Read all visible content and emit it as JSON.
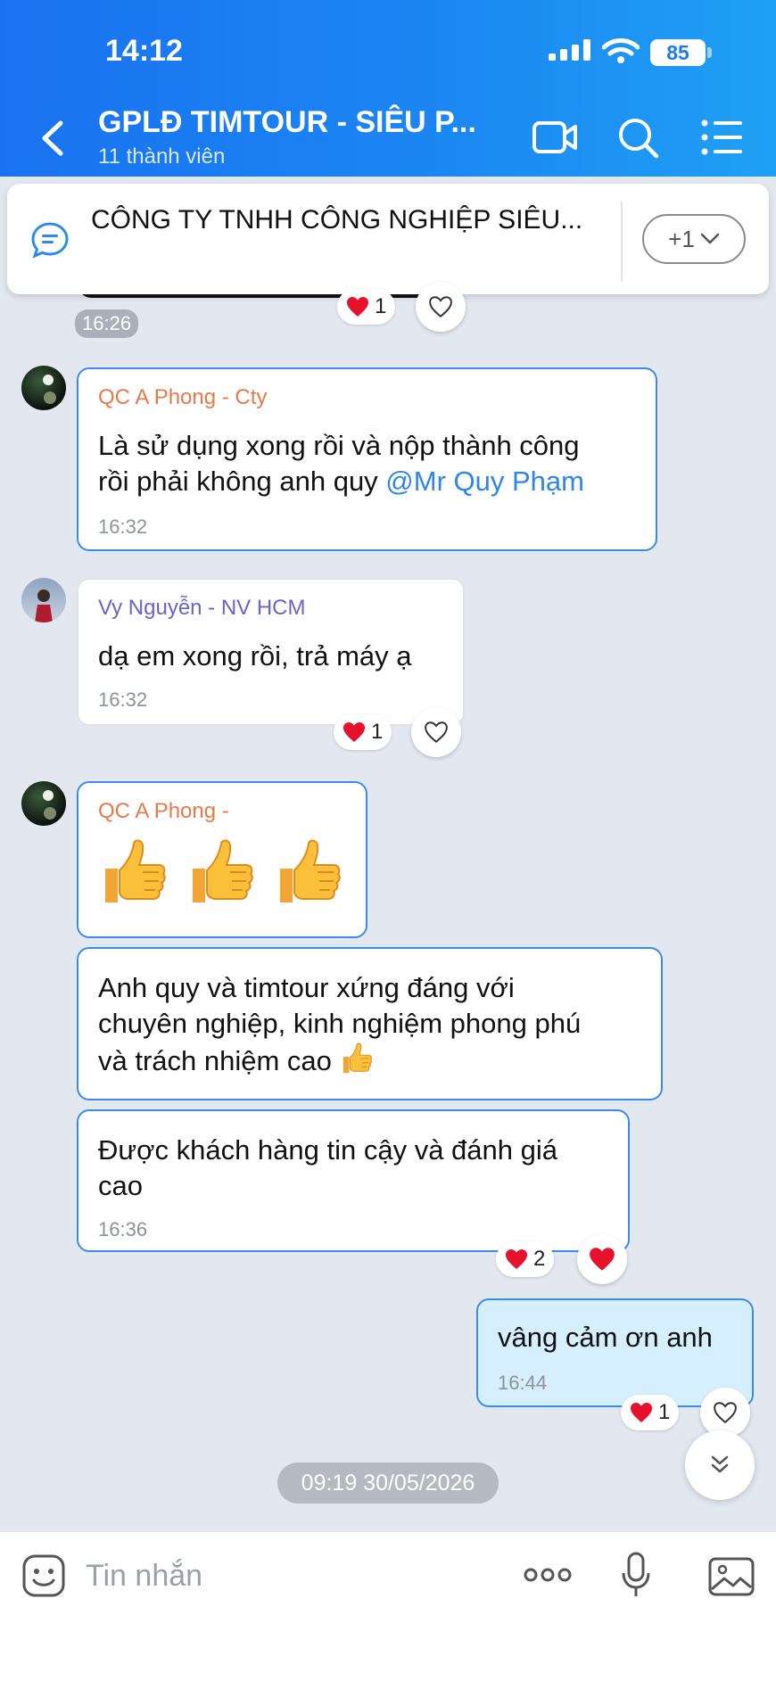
{
  "status_bar": {
    "time": "14:12",
    "battery": "85"
  },
  "header": {
    "title": "GPLĐ TIMTOUR - SIÊU P...",
    "subtitle": "11 thành viên"
  },
  "pinned": {
    "text": "CÔNG TY TNHH CÔNG NGHIỆP SIÊU...",
    "more_label": "+1"
  },
  "top_message": {
    "time": "16:26",
    "reaction_count": "1"
  },
  "messages": [
    {
      "sender": "QC A Phong - Cty",
      "line1": "Là sử dụng xong rồi và nộp thành công",
      "line2": "rồi phải không anh quy ",
      "mention": "@Mr Quy Phạm",
      "time": "16:32"
    },
    {
      "sender": "Vy Nguyễn - NV HCM",
      "text": "dạ em xong rồi, trả máy ạ",
      "time": "16:32",
      "reaction_count": "1"
    },
    {
      "sender": "QC A Phong -"
    },
    {
      "line1": "Anh quy và timtour xứng đáng với",
      "line2": "chuyên nghiệp, kinh nghiệm phong phú",
      "line3": "và trách nhiệm cao"
    },
    {
      "line1": "Được khách hàng tin cậy và đánh giá",
      "line2": "cao",
      "time": "16:36",
      "reaction_count": "2"
    },
    {
      "text": "vâng cảm ơn anh",
      "time": "16:44",
      "reaction_count": "1"
    }
  ],
  "date_divider": "09:19 30/05/2026",
  "input": {
    "placeholder": "Tin nhắn"
  },
  "icons": {
    "back": "chevron-left-icon",
    "video": "video-call-icon",
    "search": "search-icon",
    "menu": "list-menu-icon",
    "pinned": "chat-bubble-icon",
    "heart": "heart-icon",
    "emoji": "sticker-icon",
    "more": "more-dots-icon",
    "mic": "microphone-icon",
    "photo": "image-icon",
    "scroll": "double-chevron-down-icon"
  },
  "colors": {
    "header": "#1b86f2",
    "accent": "#3b8ce8",
    "sender_orange": "#e8794a",
    "sender_purple": "#6a63c9",
    "my_bubble": "#d5efff",
    "heart": "#e8112d"
  }
}
